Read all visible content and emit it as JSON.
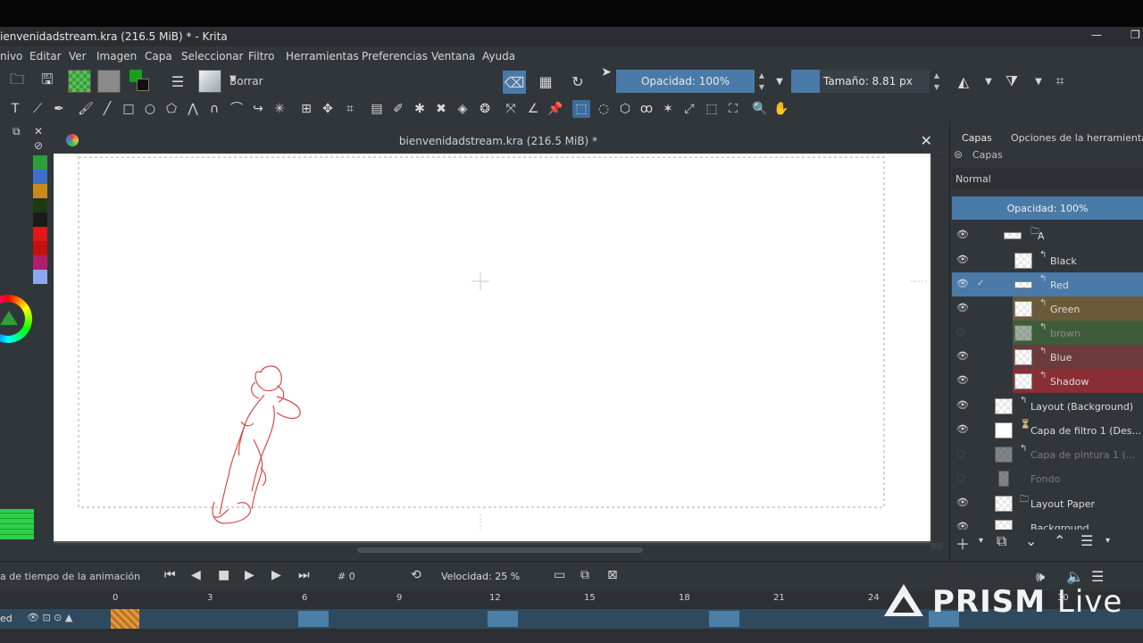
{
  "window": {
    "title": "ienvenidadstream.kra (216.5 MiB) * - Krita",
    "minimize_icon": "minimize-icon",
    "restore_icon": "restore-icon"
  },
  "menu": [
    "nivo",
    "Editar",
    "Ver",
    "Imagen",
    "Capa",
    "Seleccionar",
    "Filtro",
    "Herramientas",
    "Preferencias",
    "Ventana",
    "Ayuda"
  ],
  "toolbar": {
    "brush_preset": "Borrar",
    "opacity_label": "Opacidad: 100%",
    "size_label": "Tamaño: 8.81 px",
    "colors": {
      "fg": "#1a9e1a",
      "bg": "#8a8a8a",
      "accent": "#4a7aa8"
    }
  },
  "document": {
    "title": "bienvenidadstream.kra (216.5 MiB) *"
  },
  "right_panel": {
    "tabs": [
      "Capas",
      "Opciones de la herramienta"
    ],
    "header": "Capas",
    "blend_mode": "Normal",
    "opacity": "Opacidad:  100%",
    "layers": [
      {
        "name": "A",
        "visible": true,
        "group": true
      },
      {
        "name": "Black",
        "visible": true
      },
      {
        "name": "Red",
        "visible": true,
        "selected": true
      },
      {
        "name": "Green",
        "visible": true,
        "color": "#6b5a3a"
      },
      {
        "name": "brown",
        "visible": false,
        "color": "#3f5c3a"
      },
      {
        "name": "Blue",
        "visible": true,
        "color": "#6b3a3a"
      },
      {
        "name": "Shadow",
        "visible": true,
        "color": "#8a2e36"
      },
      {
        "name": "Layout (Background)",
        "visible": true
      },
      {
        "name": "Capa de filtro 1 (Des...",
        "visible": true
      },
      {
        "name": "Capa de pintura 1 (...",
        "visible": false
      },
      {
        "name": "Fondo",
        "visible": false
      },
      {
        "name": "Layout Paper",
        "visible": true
      },
      {
        "name": "Background",
        "visible": true
      }
    ]
  },
  "animation": {
    "label": "a de tiempo de la animación",
    "frame": "# 0",
    "speed": "Velocidad: 25 %",
    "ruler": [
      "0",
      "3",
      "6",
      "9",
      "12",
      "15",
      "18",
      "21",
      "24",
      "30"
    ],
    "track_name": "ed"
  },
  "overlay": {
    "prism_brand": "PRISM",
    "prism_live": "Live"
  }
}
